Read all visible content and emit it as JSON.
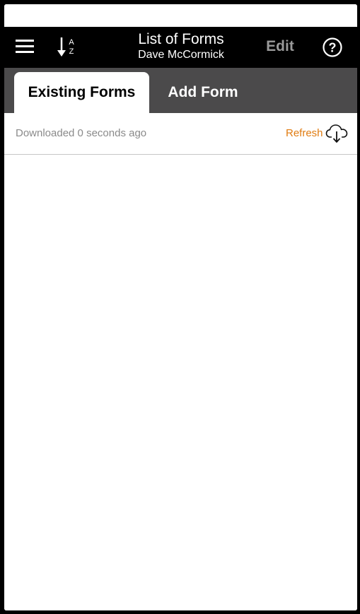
{
  "header": {
    "title": "List of Forms",
    "subtitle": "Dave McCormick",
    "edit_label": "Edit",
    "icons": {
      "menu": "menu-icon",
      "sort": "sort-alpha-icon",
      "help": "help-icon"
    },
    "sort_letters": [
      "A",
      "Z"
    ],
    "help_glyph": "?"
  },
  "tabs": [
    {
      "label": "Existing Forms",
      "active": true
    },
    {
      "label": "Add Form",
      "active": false
    }
  ],
  "sync": {
    "status": "Downloaded 0 seconds ago",
    "refresh_label": "Refresh",
    "icon": "cloud-download-icon"
  },
  "colors": {
    "navbar": "#000000",
    "tabbar": "#4b4a4b",
    "accent": "#e07b10",
    "edit_disabled": "#9a9a9a",
    "muted_text": "#8a8a8a"
  },
  "forms": []
}
